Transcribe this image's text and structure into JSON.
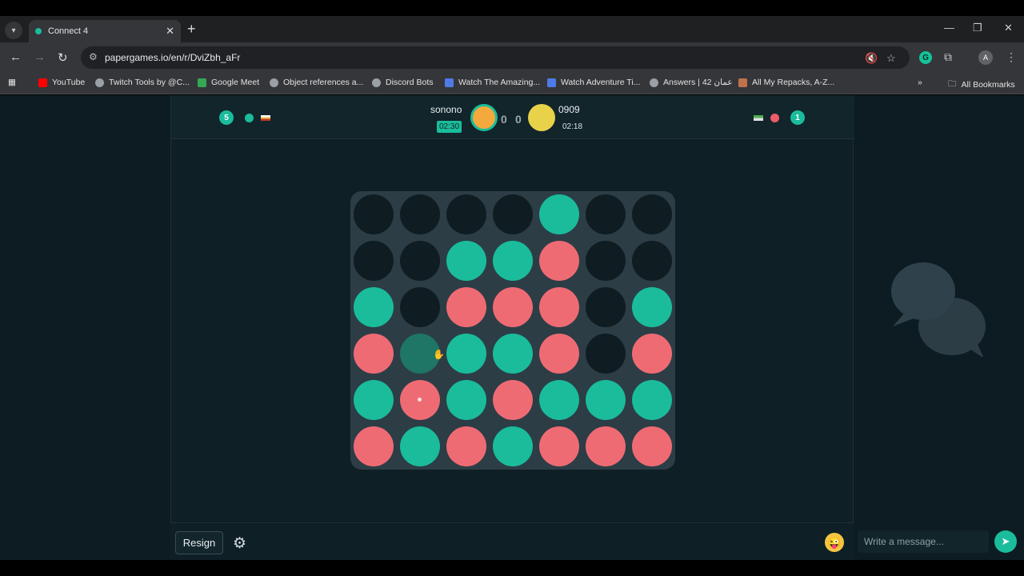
{
  "browser": {
    "tab_title": "Connect 4",
    "new_tab": "+",
    "url": "papergames.io/en/r/DviZbh_aFr",
    "bookmarks": [
      {
        "label": "YouTube",
        "color": "#ff0000"
      },
      {
        "label": "Twitch Tools by @C...",
        "color": "#9aa0a6"
      },
      {
        "label": "Google Meet",
        "color": "#34a853"
      },
      {
        "label": "Object references a...",
        "color": "#9aa0a6"
      },
      {
        "label": "Discord Bots",
        "color": "#9aa0a6"
      },
      {
        "label": "Watch The Amazing...",
        "color": "#4f7be8"
      },
      {
        "label": "Watch Adventure Ti...",
        "color": "#4f7be8"
      },
      {
        "label": "Answers | 42 عمان",
        "color": "#9aa0a6"
      },
      {
        "label": "All My Repacks, A-Z...",
        "color": "#c0724a"
      }
    ],
    "all_bookmarks": "All Bookmarks",
    "profile_initial": "A"
  },
  "game": {
    "left_player": {
      "wins": "5",
      "color": "#1abc9c"
    },
    "right_player": {
      "wins": "1",
      "color": "#ef5b6a"
    },
    "player1": {
      "name": "sonono",
      "timer": "02:30"
    },
    "player2": {
      "name": "0909",
      "timer": "02:18"
    },
    "score_left": "0",
    "score_right": "0",
    "colors": {
      "teal": "#1abc9c",
      "red": "#ef6b73",
      "empty": "#0f1d22",
      "hover": "#1f7566"
    },
    "board": [
      [
        "E",
        "E",
        "E",
        "E",
        "T",
        "E",
        "E"
      ],
      [
        "E",
        "E",
        "T",
        "T",
        "R",
        "E",
        "E"
      ],
      [
        "T",
        "E",
        "R",
        "R",
        "R",
        "E",
        "T"
      ],
      [
        "R",
        "H",
        "T",
        "T",
        "R",
        "E",
        "R"
      ],
      [
        "T",
        "R",
        "T",
        "R",
        "T",
        "T",
        "T"
      ],
      [
        "R",
        "T",
        "R",
        "T",
        "R",
        "R",
        "R"
      ]
    ],
    "last_move": {
      "row": 4,
      "col": 1
    }
  },
  "footer": {
    "resign_label": "Resign",
    "chat_placeholder": "Write a message..."
  }
}
